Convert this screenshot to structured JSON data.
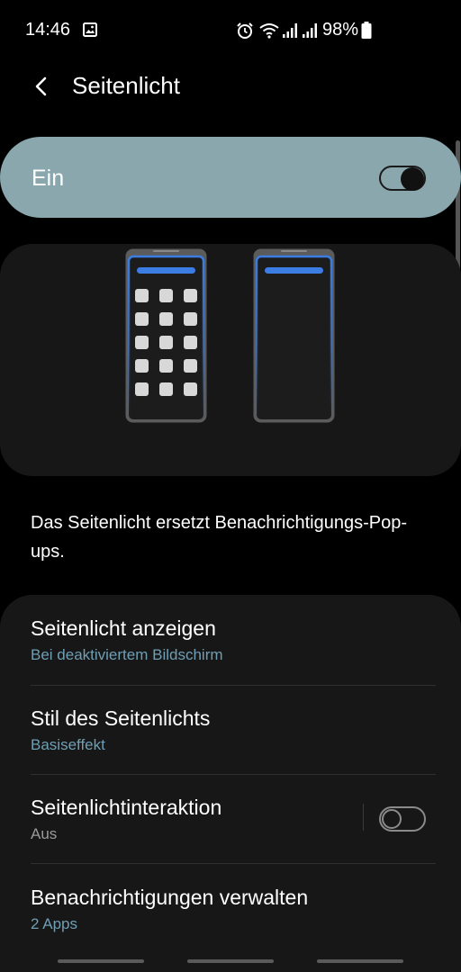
{
  "status_bar": {
    "time": "14:46",
    "battery": "98%",
    "icons": [
      "image-icon",
      "alarm-icon",
      "wifi-icon",
      "signal-icon",
      "signal-icon",
      "battery-icon"
    ]
  },
  "header": {
    "title": "Seitenlicht",
    "back_icon": "back-arrow-icon"
  },
  "master_switch": {
    "label": "Ein",
    "state": "on"
  },
  "description": "Das Seitenlicht ersetzt Benachrichtigungs-Pop-ups.",
  "settings": [
    {
      "title": "Seitenlicht anzeigen",
      "subtitle": "Bei deaktiviertem Bildschirm",
      "subtitle_color": "#6f9fb5"
    },
    {
      "title": "Stil des Seitenlichts",
      "subtitle": "Basiseffekt",
      "subtitle_color": "#6f9fb5"
    },
    {
      "title": "Seitenlichtinteraktion",
      "subtitle": "Aus",
      "subtitle_color": "#9a9a9a",
      "toggle": "off"
    },
    {
      "title": "Benachrichtigungen verwalten",
      "subtitle": "2 Apps",
      "subtitle_color": "#6f9fb5"
    }
  ],
  "colors": {
    "background": "#000000",
    "master_card": "#8aa7ad",
    "card": "#171717",
    "accent_subtitle": "#6f9fb5",
    "phone_edge_blue": "#3b7de3"
  }
}
